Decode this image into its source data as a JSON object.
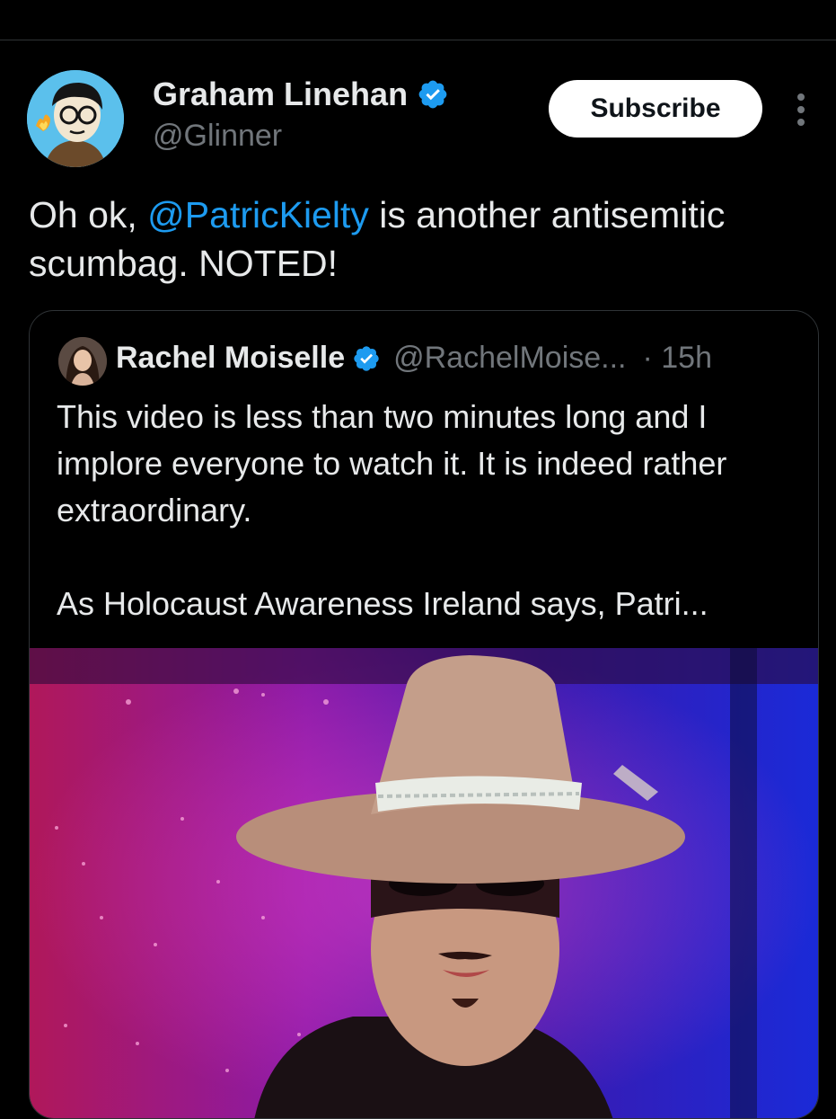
{
  "top_glyph": "ʼ",
  "post": {
    "author_name": "Graham Linehan",
    "author_handle": "@Glinner",
    "subscribe_label": "Subscribe",
    "text_mention": "@PatricKielty",
    "text_before": "Oh ok, ",
    "text_after": " is another antisemitic scumbag. NOTED!"
  },
  "quote": {
    "author_name": "Rachel Moiselle",
    "author_handle": "@RachelMoise...",
    "time": "· 15h",
    "paragraph1": "This video is less than two minutes long and I implore everyone to watch it. It is indeed rather extraordinary.",
    "paragraph2": "As Holocaust Awareness Ireland says, Patri..."
  },
  "colors": {
    "background": "#000000",
    "text": "#e7e9ea",
    "muted": "#71767b",
    "accent": "#1d9bf0",
    "border": "#2f3336"
  },
  "icons": [
    "verified-badge-icon",
    "more-options-icon"
  ]
}
